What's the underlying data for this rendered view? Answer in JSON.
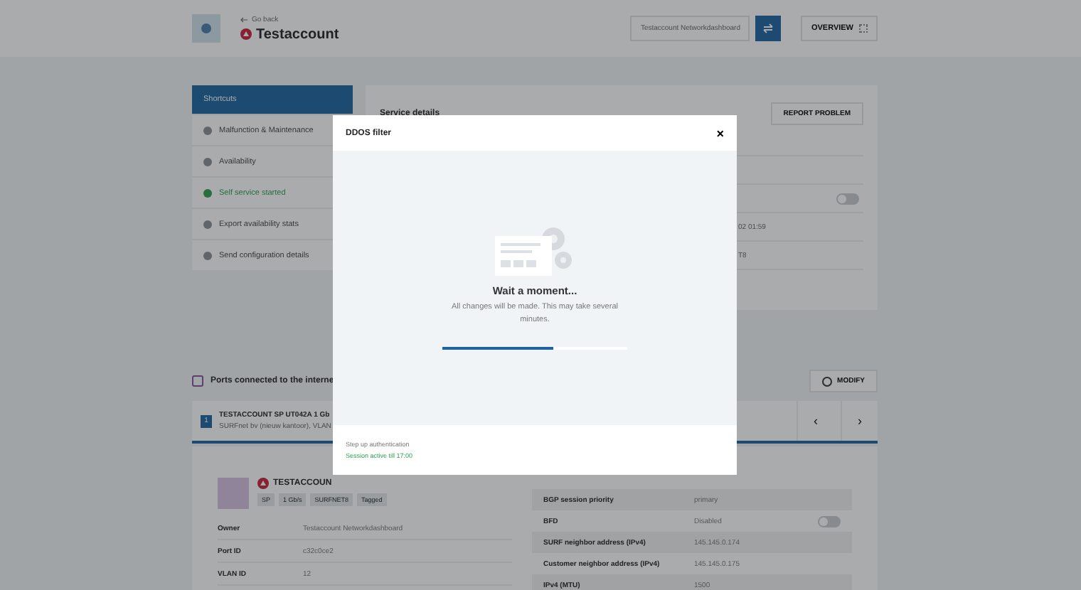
{
  "header": {
    "back_link": "Go back",
    "title": "Testaccount",
    "search": {
      "value": "Testaccount Networkdashboard"
    },
    "overview_button": "OVERVIEW"
  },
  "sidebar": {
    "title": "Shortcuts",
    "items": [
      {
        "label": "Malfunction & Maintenance",
        "kind": "link"
      },
      {
        "label": "Availability",
        "kind": "link"
      },
      {
        "label": "Self service started",
        "kind": "status"
      },
      {
        "label": "Export availability stats",
        "kind": "link"
      },
      {
        "label": "Send configuration details",
        "kind": "link"
      }
    ]
  },
  "service_details": {
    "title": "Service details",
    "report_button": "REPORT PROBLEM",
    "rows": [
      {
        "kind": "blank"
      },
      {
        "kind": "blank"
      },
      {
        "kind": "toggle",
        "on": false
      },
      {
        "kind": "text",
        "value": "02 01:59"
      },
      {
        "kind": "text",
        "value": "T8"
      }
    ]
  },
  "ports": {
    "title": "Ports connected to the interne",
    "modify_button": "MODIFY",
    "port_tab": {
      "prev": "‹",
      "next": "›",
      "number": "1",
      "name": "TESTACCOUNT SP UT042A 1 Gb",
      "subtitle": "SURFnet bv (nieuw kantoor), VLAN"
    },
    "detail": {
      "name": "TESTACCOUN",
      "tags": [
        "SP",
        "1 Gb/s",
        "SURFNET8",
        "Tagged"
      ],
      "rows": [
        {
          "label": "Owner",
          "value": "Testaccount Networkdashboard"
        },
        {
          "label": "Port ID",
          "value": "c32c0ce2"
        },
        {
          "label": "VLAN ID",
          "value": "12"
        }
      ],
      "bgp_rows": [
        {
          "label": "BGP session priority",
          "value": "primary",
          "kind": "text"
        },
        {
          "label": "BFD",
          "value": "Disabled",
          "kind": "toggle",
          "on": false
        },
        {
          "label": "SURF neighbor address (IPv4)",
          "value": "145.145.0.174",
          "kind": "text"
        },
        {
          "label": "Customer neighbor address (IPv4)",
          "value": "145.145.0.175",
          "kind": "text"
        },
        {
          "label": "IPv4 (MTU)",
          "value": "1500",
          "kind": "text"
        }
      ]
    }
  },
  "modal": {
    "title": "DDOS filter",
    "close": "×",
    "heading": "Wait a moment...",
    "message": "All changes will be made. This may take several minutes.",
    "progress": {
      "level": 0.6
    },
    "footer_label": "Step up authentication",
    "session_status": "Session active till 17:00"
  }
}
